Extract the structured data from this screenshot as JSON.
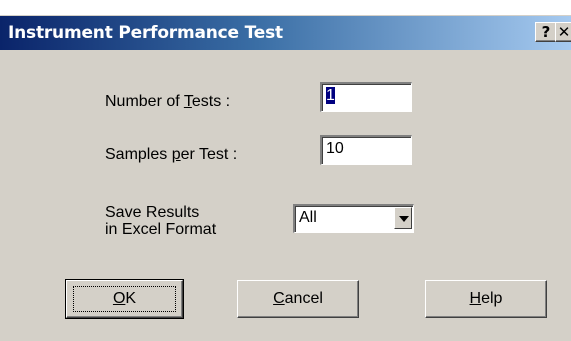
{
  "window": {
    "title": "Instrument Performance Test",
    "help_button": "?",
    "close_button": "✕"
  },
  "fields": {
    "tests_label_pre": "Number of ",
    "tests_label_key": "T",
    "tests_label_post": "ests :",
    "tests_value": "1",
    "samples_label_pre": "Samples ",
    "samples_label_key": "p",
    "samples_label_post": "er Test :",
    "samples_value": "10",
    "save_label_line1": "Save Results",
    "save_label_line2": "in Excel Format",
    "save_value": "All"
  },
  "buttons": {
    "ok_key": "O",
    "ok_rest": "K",
    "cancel_key": "C",
    "cancel_rest": "ancel",
    "help_key": "H",
    "help_rest": "elp"
  },
  "icons": {
    "dropdown": "chevron-down-icon"
  }
}
